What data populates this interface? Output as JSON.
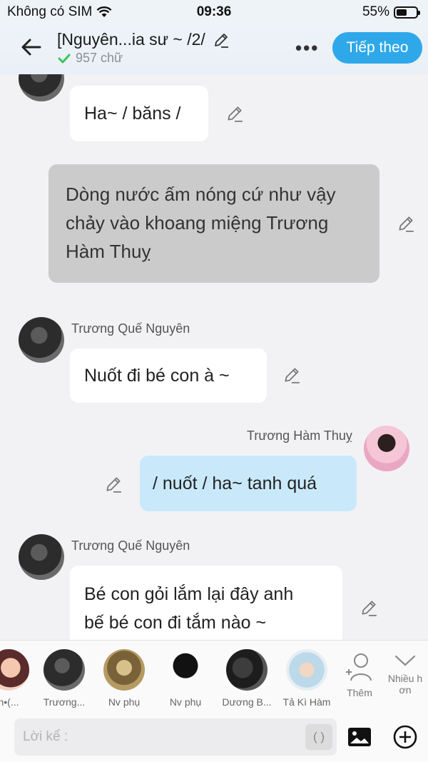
{
  "status_bar": {
    "carrier": "Không có SIM",
    "time": "09:36",
    "battery": "55%",
    "battery_level": 0.55
  },
  "header": {
    "title": "[Nguyên...ia sư ~ /2/",
    "word_count": "957 chữ",
    "more_label": "•••",
    "next_label": "Tiếp theo"
  },
  "messages": [
    {
      "speaker": "",
      "text": "Ha~ / băns /"
    },
    {
      "speaker": "",
      "text_lines": [
        "Dòng nước ấm nóng cứ như vậy",
        "chảy vào khoang miệng Trương",
        "Hàm Thuỵ"
      ]
    },
    {
      "speaker": "Trương Quế Nguyên",
      "text": "Nuốt đi bé con à ~"
    },
    {
      "speaker": "Trương Hàm Thuỵ",
      "text": "/ nuốt / ha~ tanh quá"
    },
    {
      "speaker": "Trương Quế Nguyên",
      "text_lines": [
        "Bé con gỏi lắm lại đây anh",
        "bế bé con đi tắm nào ~"
      ]
    }
  ],
  "characters": [
    {
      "name": "n•(..."
    },
    {
      "name": "Trương..."
    },
    {
      "name": "Nv phụ"
    },
    {
      "name": "Nv phụ"
    },
    {
      "name": "Dương B..."
    },
    {
      "name": "Tả Kì Hàm"
    }
  ],
  "tools": {
    "add_char": "Thêm",
    "more_line1": "Nhiều h",
    "more_line2": "ơn"
  },
  "input": {
    "placeholder": "Lời kể :",
    "paren_label": "( )"
  },
  "colors": {
    "accent": "#2fa8ea",
    "blue_bubble": "#c9e9fb",
    "gray_bubble": "#cbcbcb"
  }
}
